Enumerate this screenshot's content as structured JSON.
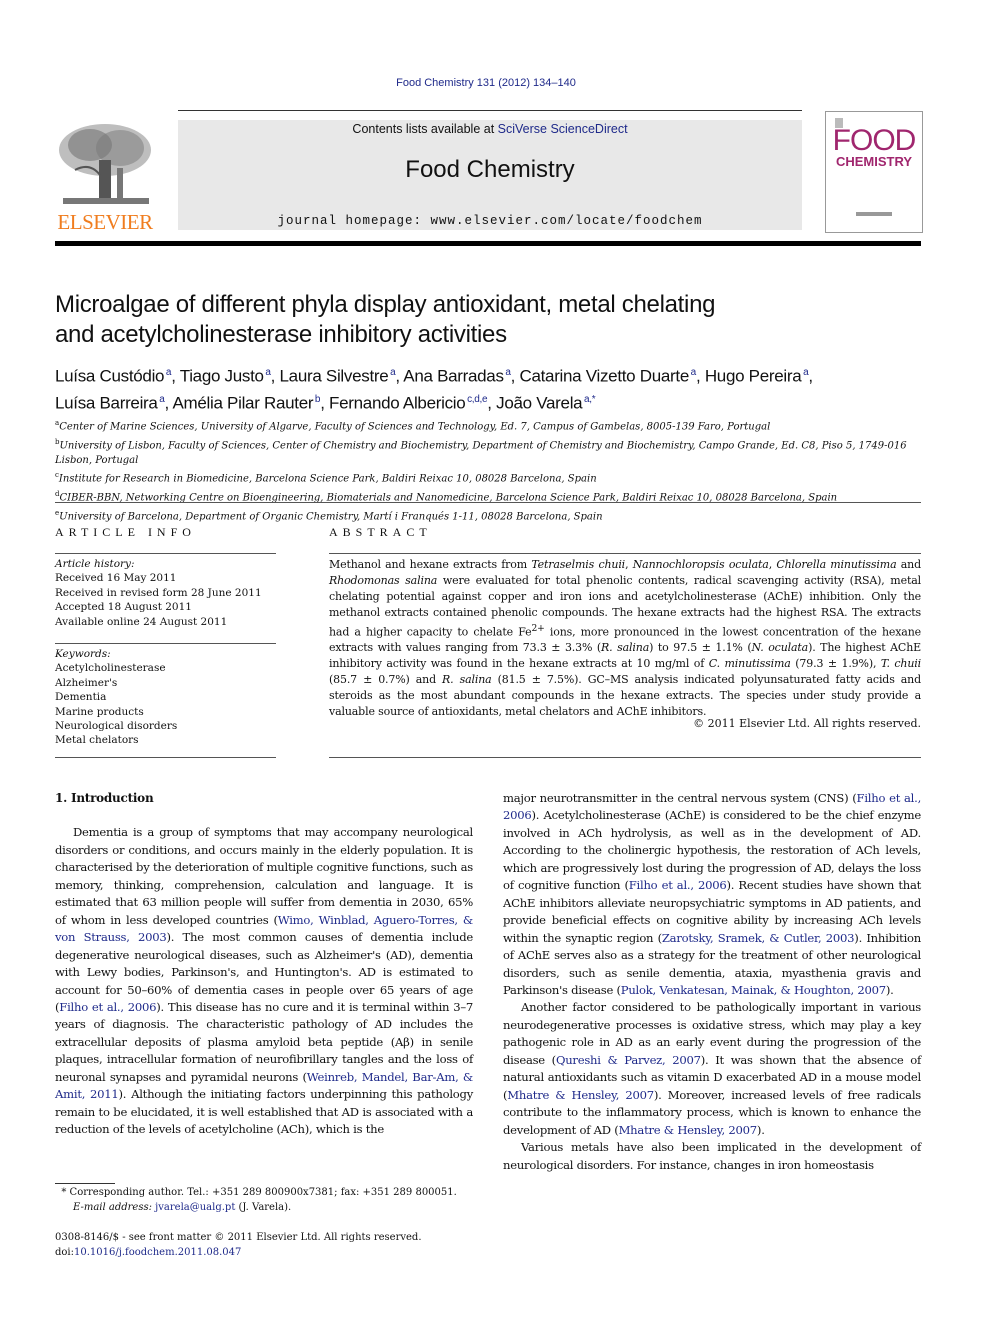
{
  "header": {
    "running_head": "Food Chemistry 131 (2012) 134–140",
    "contents_prefix": "Contents lists available at ",
    "contents_link": "SciVerse ScienceDirect",
    "journal_name": "Food Chemistry",
    "homepage": "journal homepage: www.elsevier.com/locate/foodchem",
    "publisher_logo_text": "ELSEVIER",
    "cover_title_1": "FOOD",
    "cover_title_2": "CHEMISTRY",
    "colors": {
      "link": "#1f2a8a",
      "elsevier_orange": "#f07d1f",
      "cover_magenta": "#a0266e",
      "banner_bg": "#e8e8e8"
    }
  },
  "article": {
    "title_line_1": "Microalgae of different phyla display antioxidant, metal chelating",
    "title_line_2": "and acetylcholinesterase inhibitory activities",
    "authors": [
      {
        "name": "Luísa Custódio",
        "aff": "a",
        "sep": ", "
      },
      {
        "name": "Tiago Justo",
        "aff": "a",
        "sep": ", "
      },
      {
        "name": "Laura Silvestre",
        "aff": "a",
        "sep": ", "
      },
      {
        "name": "Ana Barradas",
        "aff": "a",
        "sep": ", "
      },
      {
        "name": "Catarina Vizetto Duarte",
        "aff": "a",
        "sep": ", "
      },
      {
        "name": "Hugo Pereira",
        "aff": "a",
        "sep": ","
      },
      {
        "name": "Luísa Barreira",
        "aff": "a",
        "sep": ", "
      },
      {
        "name": "Amélia Pilar Rauter",
        "aff": "b",
        "sep": ", "
      },
      {
        "name": "Fernando Albericio",
        "aff": "c,d,e",
        "sep": ", "
      },
      {
        "name": "João Varela",
        "aff": "a,*",
        "sep": ""
      }
    ],
    "affiliations": [
      {
        "key": "a",
        "text": "Center of Marine Sciences, University of Algarve, Faculty of Sciences and Technology, Ed. 7, Campus of Gambelas, 8005-139 Faro, Portugal"
      },
      {
        "key": "b",
        "text": "University of Lisbon, Faculty of Sciences, Center of Chemistry and Biochemistry, Department of Chemistry and Biochemistry, Campo Grande, Ed. C8, Piso 5, 1749-016 Lisbon, Portugal"
      },
      {
        "key": "c",
        "text": "Institute for Research in Biomedicine, Barcelona Science Park, Baldiri Reixac 10, 08028 Barcelona, Spain"
      },
      {
        "key": "d",
        "text": "CIBER-BBN, Networking Centre on Bioengineering, Biomaterials and Nanomedicine, Barcelona Science Park, Baldiri Reixac 10, 08028 Barcelona, Spain"
      },
      {
        "key": "e",
        "text": "University of Barcelona, Department of Organic Chemistry, Martí i Franqués 1-11, 08028 Barcelona, Spain"
      }
    ]
  },
  "article_info": {
    "heading": "ARTICLE INFO",
    "history_label": "Article history:",
    "history": [
      "Received 16 May 2011",
      "Received in revised form 28 June 2011",
      "Accepted 18 August 2011",
      "Available online 24 August 2011"
    ],
    "keywords_label": "Keywords:",
    "keywords": [
      "Acetylcholinesterase",
      "Alzheimer's",
      "Dementia",
      "Marine products",
      "Neurological disorders",
      "Metal chelators"
    ]
  },
  "abstract": {
    "heading": "ABSTRACT",
    "segments": [
      {
        "t": "Methanol and hexane extracts from "
      },
      {
        "t": "Tetraselmis chuii",
        "i": true
      },
      {
        "t": ", "
      },
      {
        "t": "Nannochloropsis oculata",
        "i": true
      },
      {
        "t": ", "
      },
      {
        "t": "Chlorella minutissima",
        "i": true
      },
      {
        "t": " and "
      },
      {
        "t": "Rhodomonas salina",
        "i": true
      },
      {
        "t": " were evaluated for total phenolic contents, radical scavenging activity (RSA), metal chelating potential against copper and iron ions and acetylcholinesterase (AChE) inhibition. Only the methanol extracts contained phenolic compounds. The hexane extracts had the highest RSA. The extracts had a higher capacity to chelate Fe"
      },
      {
        "t": "2+",
        "sup": true
      },
      {
        "t": " ions, more pronounced in the lowest concentration of the hexane extracts with values ranging from 73.3 ± 3.3% ("
      },
      {
        "t": "R. salina",
        "i": true
      },
      {
        "t": ") to 97.5 ± 1.1% ("
      },
      {
        "t": "N. oculata",
        "i": true
      },
      {
        "t": "). The highest AChE inhibitory activity was found in the hexane extracts at 10 mg/ml of "
      },
      {
        "t": "C. minutissima",
        "i": true
      },
      {
        "t": " (79.3 ± 1.9%), "
      },
      {
        "t": "T. chuii",
        "i": true
      },
      {
        "t": " (85.7 ± 0.7%) and "
      },
      {
        "t": "R. salina",
        "i": true
      },
      {
        "t": " (81.5 ± 7.5%). GC–MS analysis indicated polyunsaturated fatty acids and steroids as the most abundant compounds in the hexane extracts. The species under study provide a valuable source of antioxidants, metal chelators and AChE inhibitors."
      }
    ],
    "copyright": "© 2011 Elsevier Ltd. All rights reserved."
  },
  "body": {
    "section_heading": "1. Introduction",
    "left_paragraphs": [
      [
        {
          "t": "Dementia is a group of symptoms that may accompany neurological disorders or conditions, and occurs mainly in the elderly population. It is characterised by the deterioration of multiple cognitive functions, such as memory, thinking, comprehension, calculation and language. It is estimated that 63 million people will suffer from dementia in 2030, 65% of whom in less developed countries ("
        },
        {
          "t": "Wimo, Winblad, Aguero-Torres, & von Strauss, 2003",
          "link": true
        },
        {
          "t": "). The most common causes of dementia include degenerative neurological diseases, such as Alzheimer's (AD), dementia with Lewy bodies, Parkinson's, and Huntington's. AD is estimated to account for 50–60% of dementia cases in people over 65 years of age ("
        },
        {
          "t": "Filho et al., 2006",
          "link": true
        },
        {
          "t": "). This disease has no cure and it is terminal within 3–7 years of diagnosis. The characteristic pathology of AD includes the extracellular deposits of plasma amyloid beta peptide (Aβ) in senile plaques, intracellular formation of neurofibrillary tangles and the loss of neuronal synapses and pyramidal neurons ("
        },
        {
          "t": "Weinreb, Mandel, Bar-Am, & Amit, 2011",
          "link": true
        },
        {
          "t": "). Although the initiating factors underpinning this pathology remain to be elucidated, it is well established that AD is associated with a reduction of the levels of acetylcholine (ACh), which is the"
        }
      ]
    ],
    "right_paragraphs": [
      [
        {
          "t": "major neurotransmitter in the central nervous system (CNS) ("
        },
        {
          "t": "Filho et al., 2006",
          "link": true
        },
        {
          "t": "). Acetylcholinesterase (AChE) is considered to be the chief enzyme involved in ACh hydrolysis, as well as in the development of AD. According to the cholinergic hypothesis, the restoration of ACh levels, which are progressively lost during the progression of AD, delays the loss of cognitive function ("
        },
        {
          "t": "Filho et al., 2006",
          "link": true
        },
        {
          "t": "). Recent studies have shown that AChE inhibitors alleviate neuropsychiatric symptoms in AD patients, and provide beneficial effects on cognitive ability by increasing ACh levels within the synaptic region ("
        },
        {
          "t": "Zarotsky, Sramek, & Cutler, 2003",
          "link": true
        },
        {
          "t": "). Inhibition of AChE serves also as a strategy for the treatment of other neurological disorders, such as senile dementia, ataxia, myasthenia gravis and Parkinson's disease ("
        },
        {
          "t": "Pulok, Venkatesan, Mainak, & Houghton, 2007",
          "link": true
        },
        {
          "t": ")."
        }
      ],
      [
        {
          "t": "Another factor considered to be pathologically important in various neurodegenerative processes is oxidative stress, which may play a key pathogenic role in AD as an early event during the progression of the disease ("
        },
        {
          "t": "Qureshi & Parvez, 2007",
          "link": true
        },
        {
          "t": "). It was shown that the absence of natural antioxidants such as vitamin D exacerbated AD in a mouse model ("
        },
        {
          "t": "Mhatre & Hensley, 2007",
          "link": true
        },
        {
          "t": "). Moreover, increased levels of free radicals contribute to the inflammatory process, which is known to enhance the development of AD ("
        },
        {
          "t": "Mhatre & Hensley, 2007",
          "link": true
        },
        {
          "t": ")."
        }
      ],
      [
        {
          "t": "Various metals have also been implicated in the development of neurological disorders. For instance, changes in iron homeostasis"
        }
      ]
    ]
  },
  "footnote": {
    "marker": "*",
    "corresponding": "Corresponding author. Tel.: +351 289 800900x7381; fax: +351 289 800051.",
    "email_label": "E-mail address:",
    "email": "jvarela@ualg.pt",
    "email_suffix": " (J. Varela)."
  },
  "front_matter": {
    "issn_line": "0308-8146/$ - see front matter © 2011 Elsevier Ltd. All rights reserved.",
    "doi_prefix": "doi:",
    "doi": "10.1016/j.foodchem.2011.08.047"
  }
}
